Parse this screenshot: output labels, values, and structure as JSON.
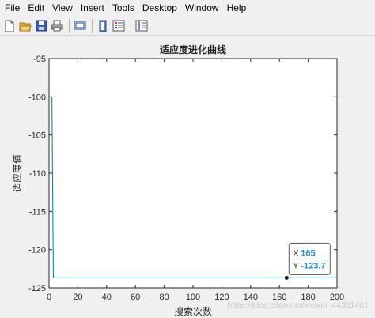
{
  "menu": {
    "items": [
      "File",
      "Edit",
      "View",
      "Insert",
      "Tools",
      "Desktop",
      "Window",
      "Help"
    ]
  },
  "toolbar": {
    "icons": [
      "new-file-icon",
      "open-folder-icon",
      "save-icon",
      "print-icon",
      "print-preview-icon",
      "link-plot-icon",
      "insert-colorbar-icon",
      "insert-legend-icon"
    ]
  },
  "datatip": {
    "x_label": "X",
    "x_value": "165",
    "y_label": "Y",
    "y_value": "-123.7"
  },
  "watermark": "https://blog.csdn.net/weixin_44331401",
  "chart_data": {
    "type": "line",
    "title": "适应度进化曲线",
    "xlabel": "搜索次数",
    "ylabel": "适应度值",
    "xlim": [
      0,
      200
    ],
    "ylim": [
      -125,
      -95
    ],
    "xticks": [
      0,
      20,
      40,
      60,
      80,
      100,
      120,
      140,
      160,
      180,
      200
    ],
    "yticks": [
      -125,
      -120,
      -115,
      -110,
      -105,
      -100,
      -95
    ],
    "grid": false,
    "line_color": "#0072bd",
    "series": [
      {
        "x": [
          1,
          2,
          3,
          200
        ],
        "y": [
          -100.0,
          -100.0,
          -123.7,
          -123.7
        ]
      }
    ],
    "datatip_point": {
      "x": 165,
      "y": -123.7
    }
  }
}
